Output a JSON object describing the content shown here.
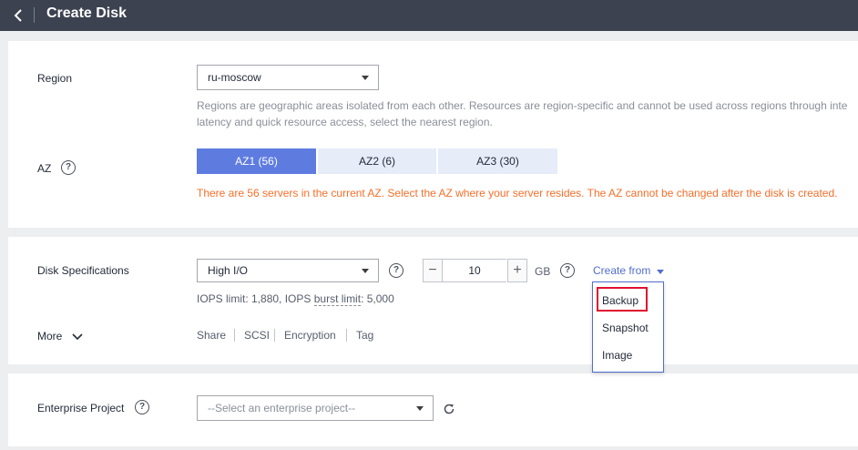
{
  "header": {
    "title": "Create Disk",
    "back_icon": "chevron-left-icon"
  },
  "region": {
    "label": "Region",
    "value": "ru-moscow",
    "hint_line1": "Regions are geographic areas isolated from each other. Resources are region-specific and cannot be used across regions through inte",
    "hint_line2": "latency and quick resource access, select the nearest region."
  },
  "az": {
    "label": "AZ",
    "options": [
      "AZ1 (56)",
      "AZ2 (6)",
      "AZ3 (30)"
    ],
    "selected": "AZ1 (56)",
    "warning": "There are 56 servers in the current AZ. Select the AZ where your server resides. The AZ cannot be changed after the disk is created."
  },
  "disk": {
    "label": "Disk Specifications",
    "type": "High I/O",
    "size": "10",
    "unit": "GB",
    "iops_prefix": "IOPS limit: 1,880, IOPS ",
    "iops_burst": "burst limit",
    "iops_suffix": ": 5,000",
    "create_from": "Create from",
    "create_from_options": [
      "Backup",
      "Snapshot",
      "Image"
    ],
    "decrement_symbol": "−",
    "increment_symbol": "+"
  },
  "more": {
    "label": "More",
    "tabs": [
      "Share",
      "SCSI",
      "Encryption",
      "Tag"
    ]
  },
  "enterprise": {
    "label": "Enterprise Project",
    "placeholder": "--Select an enterprise project--"
  },
  "help_symbol": "?",
  "colors": {
    "accent": "#5e7ce0",
    "warning": "#f66f2a",
    "link": "#526ecc",
    "highlight": "#e0102f",
    "header": "#3c4250"
  }
}
